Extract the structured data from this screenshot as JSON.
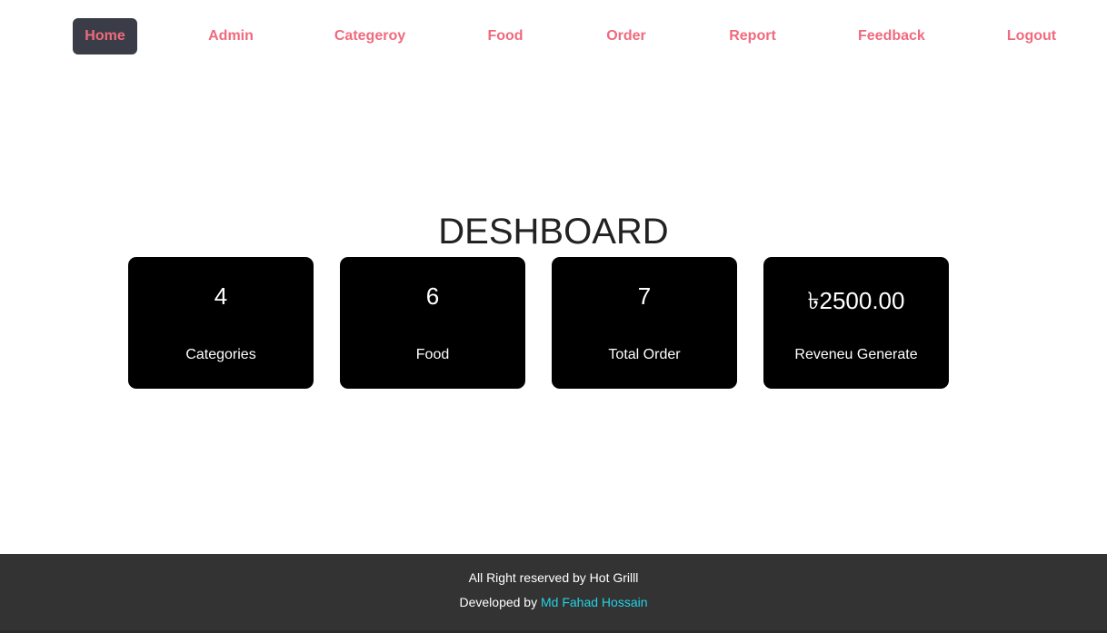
{
  "nav": {
    "items": [
      {
        "label": "Home",
        "active": true
      },
      {
        "label": "Admin"
      },
      {
        "label": "Categeroy"
      },
      {
        "label": "Food"
      },
      {
        "label": "Order"
      },
      {
        "label": "Report"
      },
      {
        "label": "Feedback"
      },
      {
        "label": "Logout"
      }
    ]
  },
  "main": {
    "title": "DESHBOARD",
    "cards": [
      {
        "value": "4",
        "label": "Categories"
      },
      {
        "value": "6",
        "label": "Food"
      },
      {
        "value": "7",
        "label": "Total Order"
      },
      {
        "value": "৳2500.00",
        "label": "Reveneu Generate"
      }
    ]
  },
  "footer": {
    "rights": "All Right reserved by Hot Grilll",
    "developed_prefix": "Developed by",
    "developer_name": "Md Fahad Hossain"
  },
  "colors": {
    "nav_text": "#f06a7e",
    "nav_active_bg": "#3a3d47",
    "card_bg": "#000000",
    "footer_bg": "#333333",
    "developer_link": "#22d3e6"
  }
}
